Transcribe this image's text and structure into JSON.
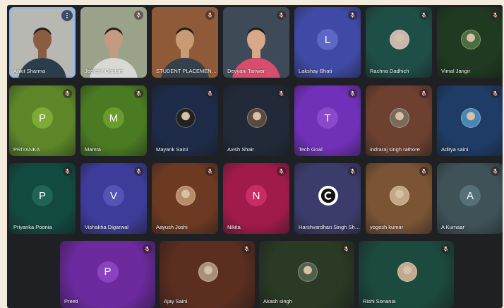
{
  "participants": [
    {
      "name": "Ankit Sharma",
      "type": "video",
      "active": true,
      "more": true,
      "bg": "#b8b8b2",
      "skin": "#8a5c42",
      "shirt": "#2b3c4a"
    },
    {
      "name": "Jeetesh Gautam",
      "type": "video",
      "bg": "#9aa38a",
      "skin": "#c49a80",
      "shirt": "#d8d8d6"
    },
    {
      "name": "STUDENT PLACEMENT C...",
      "type": "video",
      "bg": "#8e5a38",
      "skin": "#c99a74",
      "shirt": "#35404a"
    },
    {
      "name": "Devyani Tanwar",
      "type": "video",
      "bg": "#3e4a58",
      "skin": "#d8a88a",
      "shirt": "#d84c6e"
    },
    {
      "name": "Lakshay Bhati",
      "type": "letter",
      "letter": "L",
      "bg": "#3f4aa6",
      "avatar": "#5d68c6"
    },
    {
      "name": "Rachna Dadhich",
      "type": "photo",
      "bg": "#1e4f47",
      "photo": "#c8b8ac"
    },
    {
      "name": "Vimal Jangir",
      "type": "photo",
      "bg": "#1f3a20",
      "photo": "#4c6e3c"
    },
    {
      "name": "PRIYANKA",
      "type": "letter",
      "letter": "P",
      "bg": "#5c8628",
      "avatar": "#7dab36"
    },
    {
      "name": "Mamta",
      "type": "letter",
      "letter": "M",
      "bg": "#4a7a22",
      "avatar": "#6a9c2c"
    },
    {
      "name": "Mayank Saini",
      "type": "photo",
      "bg": "#1e2b48",
      "photo": "#222222"
    },
    {
      "name": "Avish Shair",
      "type": "photo",
      "bg": "#222a3a",
      "photo": "#5a4a3e"
    },
    {
      "name": "Tech Goal",
      "type": "letter",
      "letter": "T",
      "bg": "#7030b8",
      "avatar": "#8c48cc"
    },
    {
      "name": "indraraj singh rathore",
      "type": "photo",
      "bg": "#6e4030",
      "photo": "#7a6a5a"
    },
    {
      "name": "Aditya saini",
      "type": "photo",
      "bg": "#1e3c66",
      "photo": "#4a86b4"
    },
    {
      "name": "Priyanka Poonia",
      "type": "letter",
      "letter": "P",
      "bg": "#124a40",
      "avatar": "#1f6456"
    },
    {
      "name": "Vishakha Digarwal",
      "type": "letter",
      "letter": "V",
      "bg": "#3d3c9a",
      "avatar": "#5553b6"
    },
    {
      "name": "Aayush Joshi",
      "type": "photo",
      "bg": "#6c3a22",
      "photo": "#b88a66"
    },
    {
      "name": "Nikita",
      "type": "letter",
      "letter": "N",
      "bg": "#a01a4c",
      "avatar": "#c82c62"
    },
    {
      "name": "Harshvardhan Singh She...",
      "type": "logo",
      "bg": "#3c3c6c",
      "photo": "#111111"
    },
    {
      "name": "yogesh kumar",
      "type": "photo",
      "bg": "#7a5434",
      "photo": "#c4a884"
    },
    {
      "name": "A Kumaar",
      "type": "letter",
      "letter": "A",
      "bg": "#3e5258",
      "avatar": "#56707a"
    },
    {
      "name": "Preeti",
      "type": "letter",
      "letter": "P",
      "bg": "#6c2a9e",
      "avatar": "#8a42be"
    },
    {
      "name": "Ajay Saini",
      "type": "photo",
      "bg": "#5c2e20",
      "photo": "#a89078"
    },
    {
      "name": "Akash singh",
      "type": "photo",
      "bg": "#2a3a24",
      "photo": "#50604a"
    },
    {
      "name": "Rishi Sonania",
      "type": "photo",
      "bg": "#1c4a3e",
      "photo": "#c0aa90"
    }
  ],
  "icons": {
    "mic_off": "mic-off-icon",
    "more": "more-vert-icon"
  },
  "colors": {
    "page_bg": "#f3ecdc",
    "stage_bg": "#1f2023",
    "active_outline": "#8ab4f8"
  }
}
